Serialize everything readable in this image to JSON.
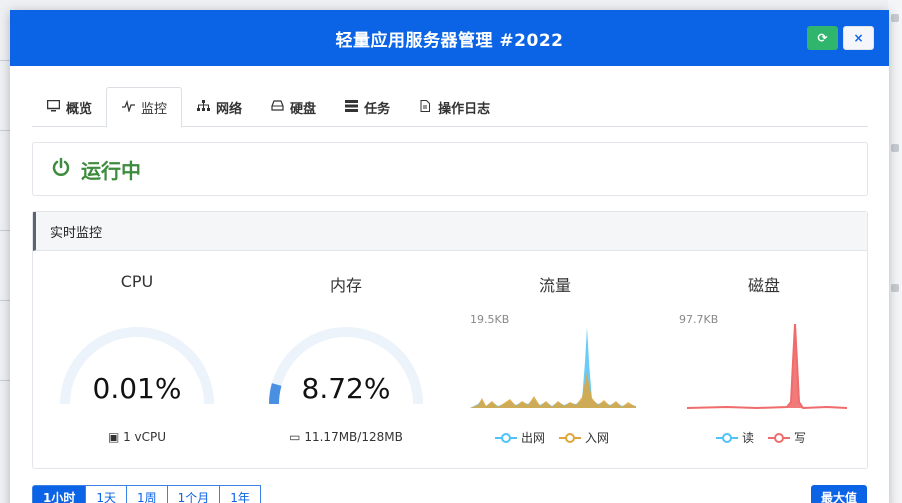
{
  "modal": {
    "title": "轻量应用服务器管理 #2022",
    "refresh_icon": "refresh-icon",
    "close_icon": "close-icon"
  },
  "tabs": [
    {
      "label": "概览",
      "icon": "monitor-icon"
    },
    {
      "label": "监控",
      "icon": "pulse-icon",
      "active": true
    },
    {
      "label": "网络",
      "icon": "network-icon"
    },
    {
      "label": "硬盘",
      "icon": "harddisk-icon"
    },
    {
      "label": "任务",
      "icon": "tasks-icon"
    },
    {
      "label": "操作日志",
      "icon": "file-icon"
    }
  ],
  "status": {
    "label": "运行中",
    "icon": "power-icon",
    "color": "#3d8b3d"
  },
  "monitor": {
    "title": "实时监控",
    "cpu": {
      "title": "CPU",
      "value": "0.01%",
      "percent": 0.01,
      "foot": "1 vCPU",
      "foot_icon": "cpu-icon"
    },
    "memory": {
      "title": "内存",
      "value": "8.72%",
      "percent": 8.72,
      "foot": "11.17MB/128MB",
      "foot_icon": "memory-icon"
    },
    "traffic": {
      "title": "流量",
      "max_label": "19.5KB",
      "legend": [
        "出网",
        "入网"
      ],
      "colors": [
        "#4fc3f7",
        "#e0a53a"
      ]
    },
    "disk": {
      "title": "磁盘",
      "max_label": "97.7KB",
      "legend": [
        "读",
        "写"
      ],
      "colors": [
        "#4fc3f7",
        "#f06b6b"
      ]
    }
  },
  "ranges": [
    "1小时",
    "1天",
    "1周",
    "1个月",
    "1年"
  ],
  "active_range": "1小时",
  "max_button": "最大值",
  "gauge_color": "#4a90e2",
  "gauge_track_color": "#edf3fb"
}
